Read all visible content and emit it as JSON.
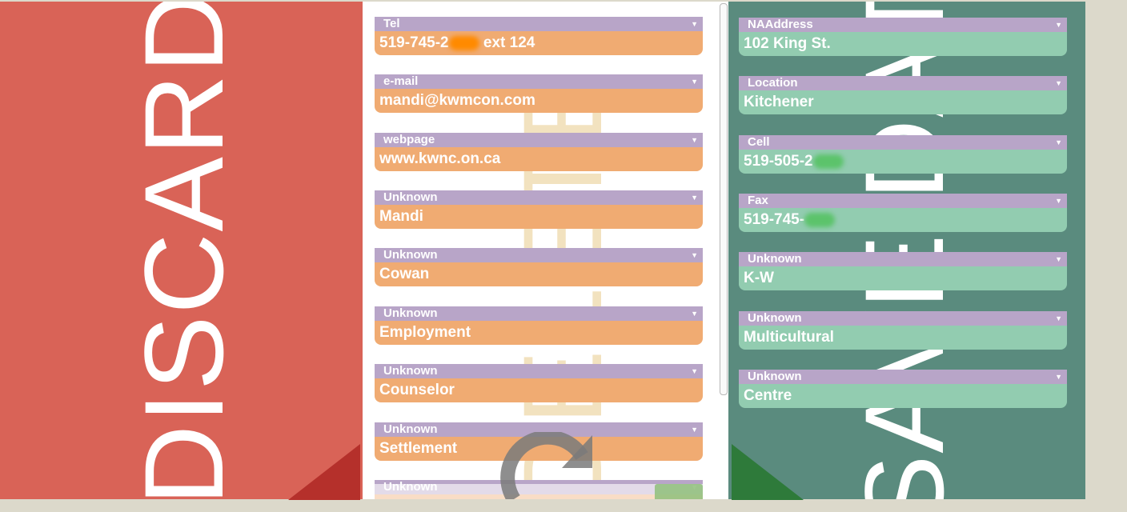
{
  "discard": {
    "label": "DISCARD"
  },
  "save": {
    "label": "SAVE DATA"
  },
  "middle_watermark": "DELETE",
  "left_fields": [
    {
      "label": "Tel",
      "value": "519-745-2",
      "value_suffix": " ext 124",
      "redacted": true
    },
    {
      "label": "e-mail",
      "value": "mandi@kwmcon.com"
    },
    {
      "label": "webpage",
      "value": "www.kwnc.on.ca"
    },
    {
      "label": "Unknown",
      "value": "Mandi"
    },
    {
      "label": "Unknown",
      "value": "Cowan"
    },
    {
      "label": "Unknown",
      "value": "Employment"
    },
    {
      "label": "Unknown",
      "value": "Counselor"
    },
    {
      "label": "Unknown",
      "value": "Settlement"
    },
    {
      "label": "Unknown",
      "value": ""
    }
  ],
  "right_fields": [
    {
      "label": "NAAddress",
      "value": "102 King St."
    },
    {
      "label": "Location",
      "value": "Kitchener"
    },
    {
      "label": "Cell",
      "value": "519-505-2",
      "redacted": true
    },
    {
      "label": "Fax",
      "value": "519-745-",
      "redacted": true
    },
    {
      "label": "Unknown",
      "value": "K-W"
    },
    {
      "label": "Unknown",
      "value": "Multicultural"
    },
    {
      "label": "Unknown",
      "value": "Centre"
    }
  ],
  "dropdown_caret": "▼",
  "colors": {
    "discard_bg": "#d96357",
    "save_bg": "#5a8b7e",
    "label_bg": "#b8a5c8",
    "left_value_bg": "#f0ab72",
    "right_value_bg": "#92ccb0"
  }
}
